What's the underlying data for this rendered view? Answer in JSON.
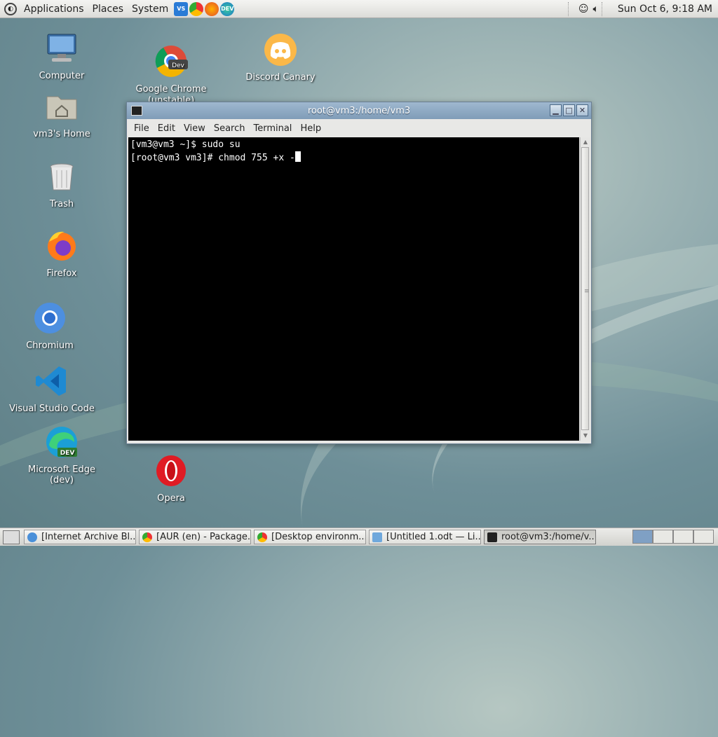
{
  "top_panel": {
    "menus": [
      "Applications",
      "Places",
      "System"
    ],
    "clock": "Sun Oct  6,  9:18 AM"
  },
  "desktop_icons": [
    {
      "label": "Computer"
    },
    {
      "label": "vm3's Home"
    },
    {
      "label": "Trash"
    },
    {
      "label": "Firefox"
    },
    {
      "label": "Chromium"
    },
    {
      "label": "Visual Studio Code"
    },
    {
      "label": "Microsoft Edge (dev)"
    },
    {
      "label": "Google Chrome\n(unstable)"
    },
    {
      "label": "Discord Canary"
    },
    {
      "label": "Opera"
    }
  ],
  "terminal": {
    "title": "root@vm3:/home/vm3",
    "menu": [
      "File",
      "Edit",
      "View",
      "Search",
      "Terminal",
      "Help"
    ],
    "lines": [
      "[vm3@vm3 ~]$ sudo su",
      "[root@vm3 vm3]# chmod 755 +x -"
    ]
  },
  "taskbar": {
    "tasks": [
      {
        "label": "[Internet Archive Bl...",
        "color": "#4a90d9"
      },
      {
        "label": "[AUR (en) - Package...",
        "color": "#4caf50"
      },
      {
        "label": "[Desktop environm...",
        "color": "#4caf50"
      },
      {
        "label": "[Untitled 1.odt — Li...",
        "color": "#6fa8dc"
      },
      {
        "label": "root@vm3:/home/v...",
        "color": "#222222"
      }
    ]
  }
}
